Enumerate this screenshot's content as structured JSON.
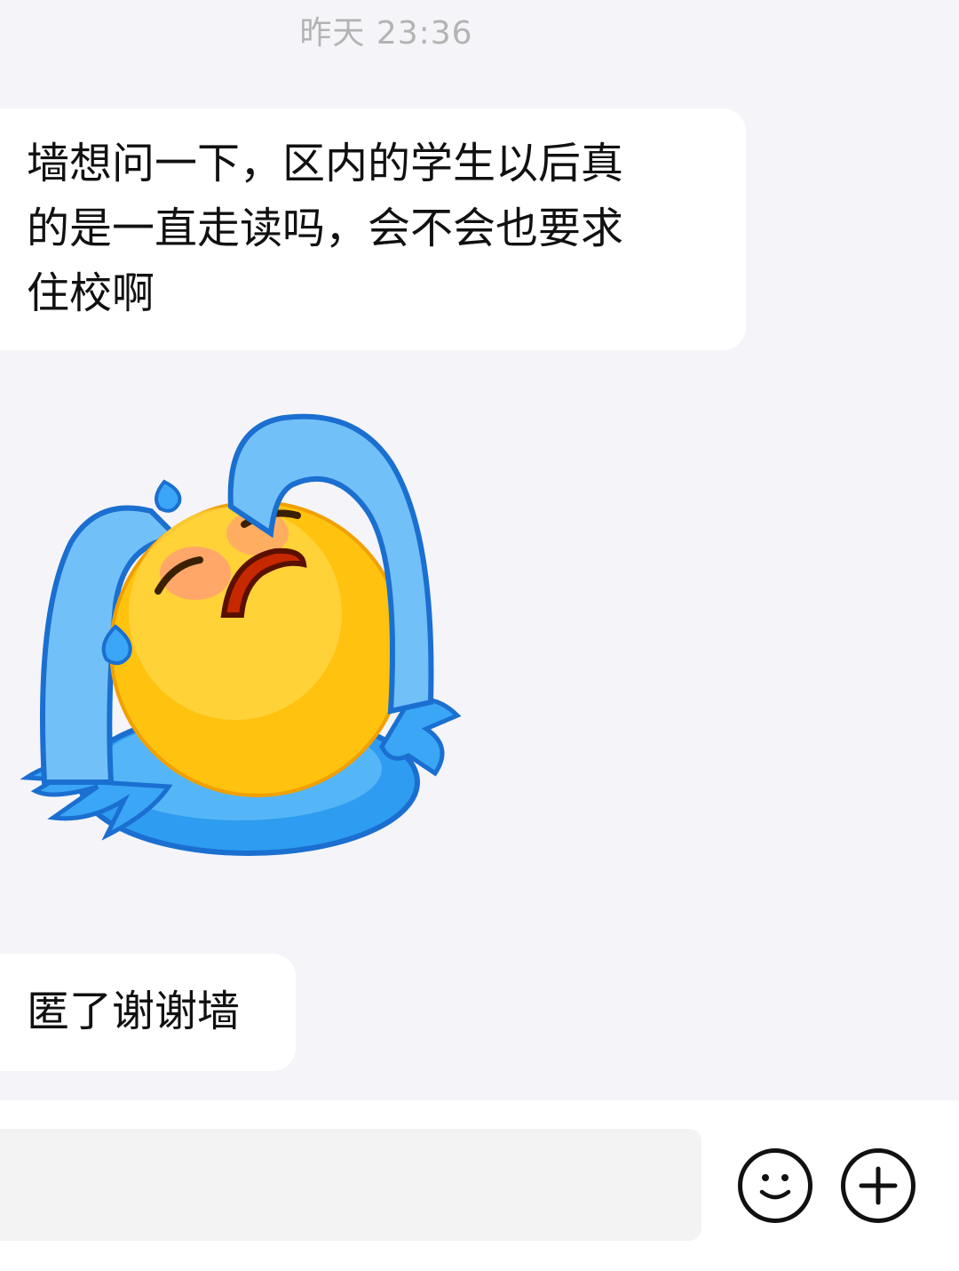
{
  "timestamp": "昨天 23:36",
  "messages": [
    {
      "lines": [
        "墙想问一下，区内的学生以后真",
        "的是一直走读吗，会不会也要求",
        "住校啊"
      ]
    },
    {
      "sticker": "crying-emoji-sticker"
    },
    {
      "text": "匿了谢谢墙"
    }
  ],
  "input": {
    "value": "",
    "placeholder": ""
  },
  "icons": {
    "emoji": "smiley-icon",
    "more": "plus-icon"
  },
  "colors": {
    "background": "#f5f4f8",
    "bubble": "#ffffff",
    "timestamp": "#b3b3b3",
    "sticker_tears": "#3aa6f5",
    "sticker_face": "#ffc20e"
  }
}
